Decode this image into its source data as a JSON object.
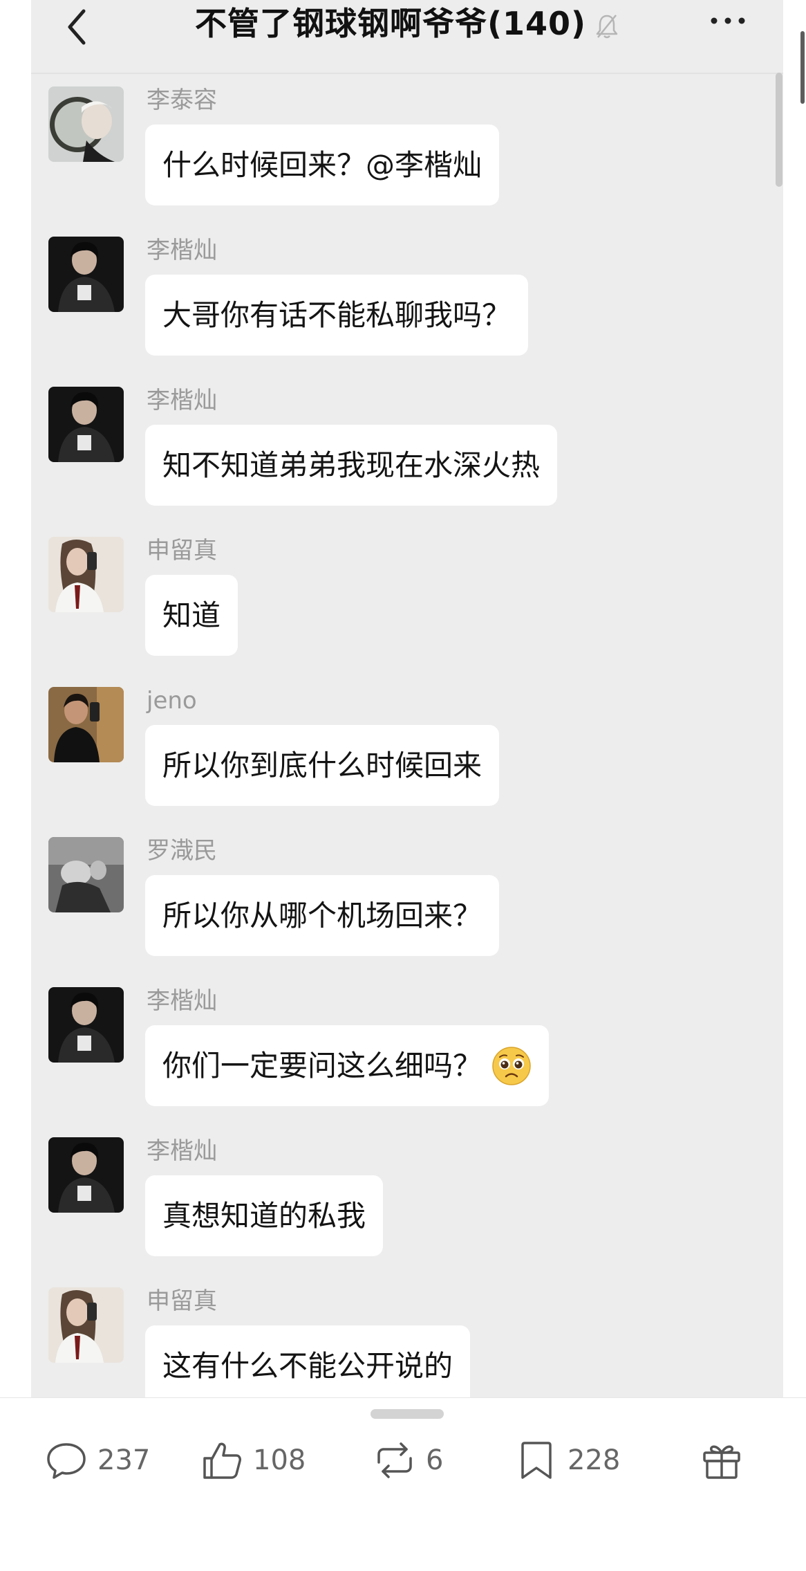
{
  "header": {
    "title": "不管了钢球钢啊爷爷(140)"
  },
  "messages": [
    {
      "name": "李泰容",
      "text": "什么时候回来？@李楷灿",
      "avatar": "avatar-taeyong"
    },
    {
      "name": "李楷灿",
      "text": "大哥你有话不能私聊我吗？",
      "avatar": "avatar-haechan"
    },
    {
      "name": "李楷灿",
      "text": "知不知道弟弟我现在水深火热",
      "avatar": "avatar-haechan"
    },
    {
      "name": "申留真",
      "text": "知道",
      "avatar": "avatar-ryujin"
    },
    {
      "name": "jeno",
      "text": "所以你到底什么时候回来",
      "avatar": "avatar-jeno"
    },
    {
      "name": "罗渽民",
      "text": "所以你从哪个机场回来？",
      "avatar": "avatar-jaemin"
    },
    {
      "name": "李楷灿",
      "text": "你们一定要问这么细吗？",
      "avatar": "avatar-haechan",
      "emoji": "pleading-face-emoji"
    },
    {
      "name": "李楷灿",
      "text": "真想知道的私我",
      "avatar": "avatar-haechan"
    },
    {
      "name": "申留真",
      "text": "这有什么不能公开说的",
      "avatar": "avatar-ryujin"
    }
  ],
  "actions": {
    "comments": "237",
    "likes": "108",
    "reposts": "6",
    "favorites": "228"
  },
  "icons": [
    "back-icon",
    "mute-bell-icon",
    "more-icon",
    "comment-icon",
    "like-icon",
    "repost-icon",
    "bookmark-icon",
    "gift-icon"
  ]
}
